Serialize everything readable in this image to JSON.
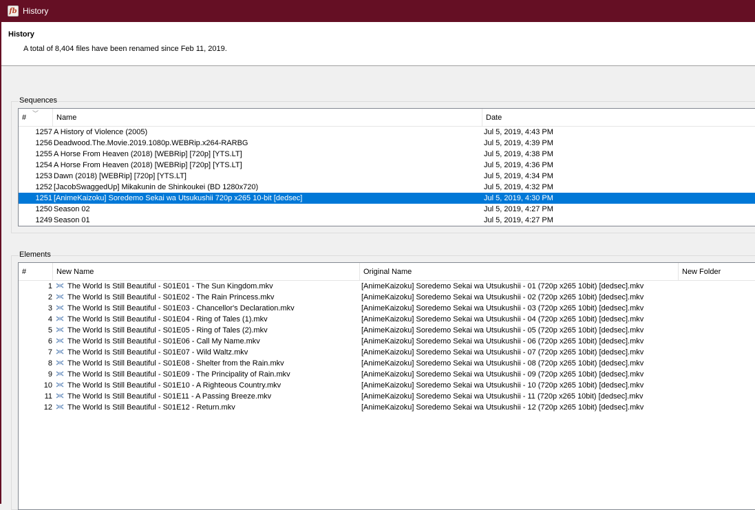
{
  "window": {
    "title": "History",
    "logo": "fb"
  },
  "header": {
    "title": "History",
    "summary": "A total of 8,404 files have been renamed since Feb 11, 2019."
  },
  "sequences": {
    "label": "Sequences",
    "columns": [
      "#",
      "Name",
      "Date"
    ],
    "rows": [
      {
        "num": "1257",
        "name": "A History of Violence (2005)",
        "date": "Jul 5, 2019, 4:43 PM"
      },
      {
        "num": "1256",
        "name": "Deadwood.The.Movie.2019.1080p.WEBRip.x264-RARBG",
        "date": "Jul 5, 2019, 4:39 PM"
      },
      {
        "num": "1255",
        "name": "A Horse From Heaven (2018) [WEBRip] [720p] [YTS.LT]",
        "date": "Jul 5, 2019, 4:38 PM"
      },
      {
        "num": "1254",
        "name": "A Horse From Heaven (2018) [WEBRip] [720p] [YTS.LT]",
        "date": "Jul 5, 2019, 4:36 PM"
      },
      {
        "num": "1253",
        "name": "Dawn (2018) [WEBRip] [720p] [YTS.LT]",
        "date": "Jul 5, 2019, 4:34 PM"
      },
      {
        "num": "1252",
        "name": "[JacobSwaggedUp] Mikakunin de Shinkoukei (BD 1280x720)",
        "date": "Jul 5, 2019, 4:32 PM"
      },
      {
        "num": "1251",
        "name": "[AnimeKaizoku] Soredemo Sekai wa Utsukushii 720p x265 10-bit [dedsec]",
        "date": "Jul 5, 2019, 4:30 PM",
        "selected": true
      },
      {
        "num": "1250",
        "name": "Season 02",
        "date": "Jul 5, 2019, 4:27 PM"
      },
      {
        "num": "1249",
        "name": "Season 01",
        "date": "Jul 5, 2019, 4:27 PM"
      }
    ]
  },
  "elements": {
    "label": "Elements",
    "columns": [
      "#",
      "New Name",
      "Original Name",
      "New Folder"
    ],
    "rows": [
      {
        "num": "1",
        "new": "The World Is Still Beautiful - S01E01 - The Sun Kingdom.mkv",
        "orig": "[AnimeKaizoku] Soredemo Sekai wa Utsukushii - 01 (720p x265 10bit) [dedsec].mkv"
      },
      {
        "num": "2",
        "new": "The World Is Still Beautiful - S01E02 - The Rain Princess.mkv",
        "orig": "[AnimeKaizoku] Soredemo Sekai wa Utsukushii - 02 (720p x265 10bit) [dedsec].mkv"
      },
      {
        "num": "3",
        "new": "The World Is Still Beautiful - S01E03 - Chancellor's Declaration.mkv",
        "orig": "[AnimeKaizoku] Soredemo Sekai wa Utsukushii - 03 (720p x265 10bit) [dedsec].mkv"
      },
      {
        "num": "4",
        "new": "The World Is Still Beautiful - S01E04 - Ring of Tales (1).mkv",
        "orig": "[AnimeKaizoku] Soredemo Sekai wa Utsukushii - 04 (720p x265 10bit) [dedsec].mkv"
      },
      {
        "num": "5",
        "new": "The World Is Still Beautiful - S01E05 - Ring of Tales (2).mkv",
        "orig": "[AnimeKaizoku] Soredemo Sekai wa Utsukushii - 05 (720p x265 10bit) [dedsec].mkv"
      },
      {
        "num": "6",
        "new": "The World Is Still Beautiful - S01E06 - Call My Name.mkv",
        "orig": "[AnimeKaizoku] Soredemo Sekai wa Utsukushii - 06 (720p x265 10bit) [dedsec].mkv"
      },
      {
        "num": "7",
        "new": "The World Is Still Beautiful - S01E07 - Wild Waltz.mkv",
        "orig": "[AnimeKaizoku] Soredemo Sekai wa Utsukushii - 07 (720p x265 10bit) [dedsec].mkv"
      },
      {
        "num": "8",
        "new": "The World Is Still Beautiful - S01E08 - Shelter from the Rain.mkv",
        "orig": "[AnimeKaizoku] Soredemo Sekai wa Utsukushii - 08 (720p x265 10bit) [dedsec].mkv"
      },
      {
        "num": "9",
        "new": "The World Is Still Beautiful - S01E09 - The Principality of Rain.mkv",
        "orig": "[AnimeKaizoku] Soredemo Sekai wa Utsukushii - 09 (720p x265 10bit) [dedsec].mkv"
      },
      {
        "num": "10",
        "new": "The World Is Still Beautiful - S01E10 - A Righteous Country.mkv",
        "orig": "[AnimeKaizoku] Soredemo Sekai wa Utsukushii - 10 (720p x265 10bit) [dedsec].mkv"
      },
      {
        "num": "11",
        "new": "The World Is Still Beautiful - S01E11 - A Passing Breeze.mkv",
        "orig": "[AnimeKaizoku] Soredemo Sekai wa Utsukushii - 11 (720p x265 10bit) [dedsec].mkv"
      },
      {
        "num": "12",
        "new": "The World Is Still Beautiful - S01E12 - Return.mkv",
        "orig": "[AnimeKaizoku] Soredemo Sekai wa Utsukushii - 12 (720p x265 10bit) [dedsec].mkv"
      }
    ]
  },
  "colors": {
    "titlebar": "#650f24",
    "selection": "#0078d7"
  }
}
